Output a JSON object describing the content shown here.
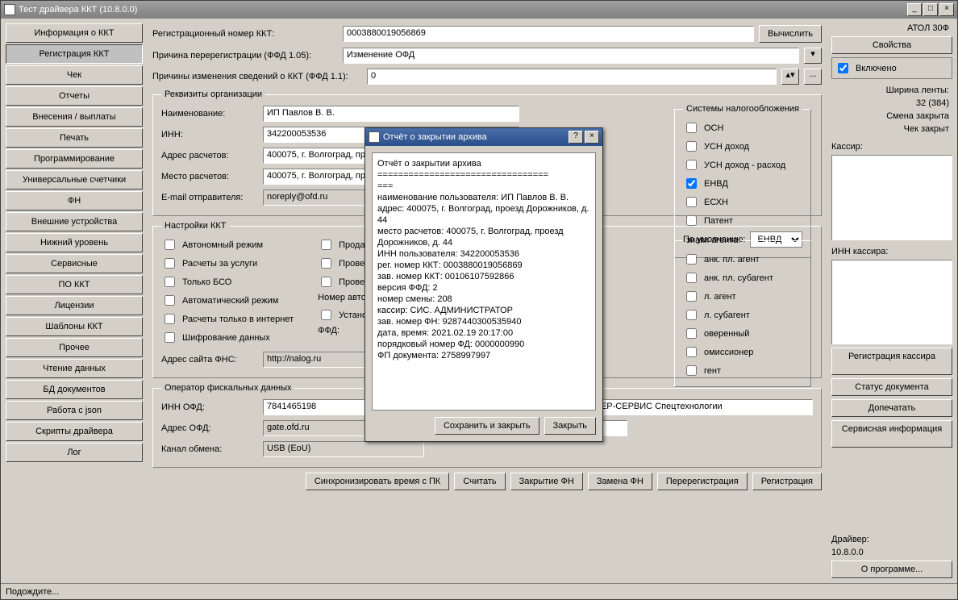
{
  "window": {
    "title": "Тест драйвера ККТ (10.8.0.0)"
  },
  "nav": {
    "items": [
      "Информация о ККТ",
      "Регистрация ККТ",
      "Чек",
      "Отчеты",
      "Внесения / выплаты",
      "Печать",
      "Программирование",
      "Универсальные счетчики",
      "ФН",
      "Внешние устройства",
      "Нижний уровень",
      "Сервисные",
      "ПО ККТ",
      "Лицензии",
      "Шаблоны ККТ",
      "Прочее",
      "Чтение данных",
      "БД документов",
      "Работа с json",
      "Скрипты драйвера",
      "Лог"
    ],
    "active_index": 1
  },
  "top": {
    "reg_label": "Регистрационный номер ККТ:",
    "reg_value": "0003880019056869",
    "calc_btn": "Вычислить",
    "rereg_label": "Причина перерегистрации (ФФД 1.05):",
    "rereg_value": "Изменение ОФД",
    "reasons_label": "Причины изменения сведений о ККТ (ФФД 1.1):",
    "reasons_value": "0",
    "dots": "..."
  },
  "org": {
    "legend": "Реквизиты организации",
    "name_lbl": "Наименование:",
    "name_val": "ИП Павлов В. В.",
    "inn_lbl": "ИНН:",
    "inn_val": "342200053536",
    "addr_lbl": "Адрес расчетов:",
    "addr_val": "400075, г. Волгоград, про",
    "place_lbl": "Место расчетов:",
    "place_val": "400075, г. Волгоград, про",
    "email_lbl": "E-mail отправителя:",
    "email_val": "noreply@ofd.ru"
  },
  "tax": {
    "legend": "Системы налогообложения",
    "items": [
      "ОСН",
      "УСН доход",
      "УСН доход - расход",
      "ЕНВД",
      "ЕСХН",
      "Патент"
    ],
    "checked_index": 3,
    "default_lbl": "По умолчанию:",
    "default_val": "ЕНВД"
  },
  "settings": {
    "legend": "Настройки ККТ",
    "left": [
      "Автономный режим",
      "Расчеты за услуги",
      "Только БСО",
      "Автоматический режим",
      "Расчеты только в интернет",
      "Шифрование данных"
    ],
    "right": [
      "Продажа пода",
      "Проведение а",
      "Проведение л"
    ],
    "auto_num_lbl": "Номер автомата:",
    "install_lbl": "Установка пр в автомате",
    "ffd_lbl": "ФФД:",
    "fns_lbl": "Адрес сайта ФНС:",
    "fns_val": "http://nalog.ru"
  },
  "agent": {
    "legend": "знаки агента",
    "items": [
      "анк. пл. агент",
      "анк. пл. субагент",
      "л. агент",
      "л. субагент",
      "оверенный",
      "омиссионер",
      "гент"
    ]
  },
  "ofd": {
    "legend": "Оператор фискальных данных",
    "inn_lbl": "ИНН ОФД:",
    "inn_val": "7841465198",
    "addr_lbl": "Адрес ОФД:",
    "addr_val": "gate.ofd.ru",
    "chan_lbl": "Канал обмена:",
    "chan_val": "USB (EoU)",
    "name_val": "ПЕТЕР-СЕРВИС Спецтехнологии",
    "ver_val": ".8"
  },
  "bottom_btns": [
    "Синхронизировать время с ПК",
    "Считать",
    "Закрытие ФН",
    "Замена ФН",
    "Перерегистрация",
    "Регистрация"
  ],
  "right": {
    "model": "АТОЛ 30Ф",
    "props_btn": "Свойства",
    "enabled_lbl": "Включено",
    "width_lbl": "Ширина ленты:",
    "width_val": "32 (384)",
    "shift_lbl": "Смена закрыта",
    "chk_lbl": "Чек закрыт",
    "cashier_lbl": "Кассир:",
    "cashier_inn_lbl": "ИНН кассира:",
    "reg_cashier_btn": "Регистрация кассира",
    "doc_status_btn": "Статус документа",
    "reprint_btn": "Допечатать",
    "service_btn": "Сервисная информация",
    "driver_lbl": "Драйвер:",
    "driver_ver": "10.8.0.0",
    "about_btn": "О программе..."
  },
  "status": "Подождите...",
  "dialog": {
    "title": "Отчёт о закрытии архива",
    "report": "Отчёт о закрытии архива\n=================================\n===\nнаименование пользователя: ИП Павлов В. В.\nадрес: 400075, г. Волгоград, проезд Дорожников, д. 44\nместо расчетов: 400075, г. Волгоград, проезд Дорожников, д. 44\nИНН пользователя: 342200053536\nрег. номер ККТ: 0003880019056869\nзав. номер ККТ: 00106107592866\nверсия ФФД: 2\nномер смены: 208\nкассир: СИС. АДМИНИСТРАТОР\nзав. номер ФН: 9287440300535940\nдата, время: 2021.02.19 20:17:00\nпорядковый номер ФД: 0000000990\nФП документа: 2758997997",
    "save_btn": "Сохранить и закрыть",
    "close_btn": "Закрыть"
  }
}
